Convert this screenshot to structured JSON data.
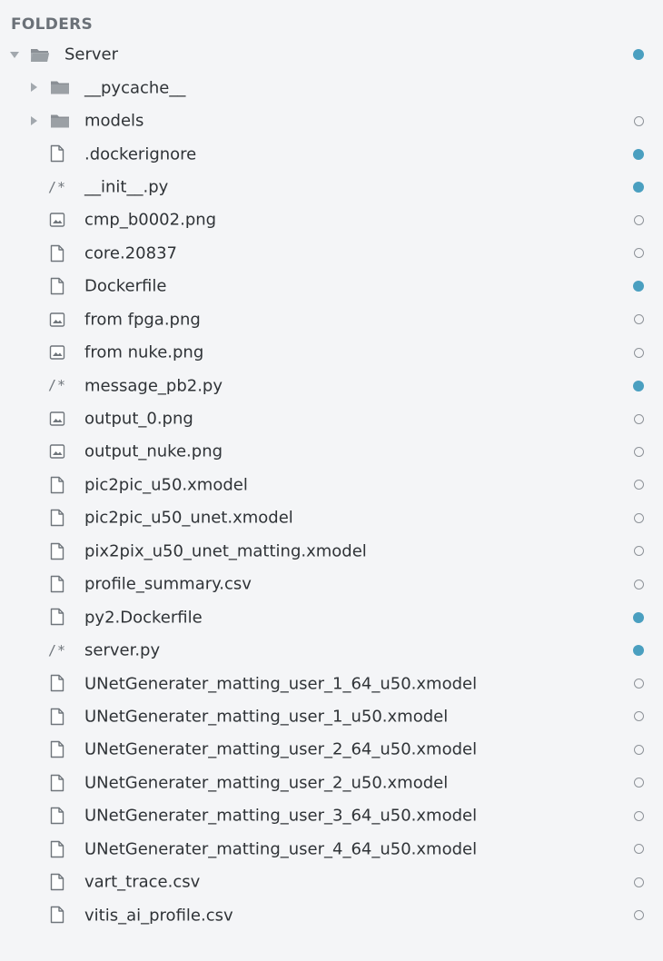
{
  "sidebar": {
    "header": "FOLDERS",
    "root": {
      "label": "Server",
      "icon": "folder-open-icon",
      "expanded": true,
      "status": "modified"
    },
    "items": [
      {
        "label": "__pycache__",
        "kind": "folder",
        "icon": "folder-icon",
        "expanded": false,
        "status": "none"
      },
      {
        "label": "models",
        "kind": "folder",
        "icon": "folder-icon",
        "expanded": false,
        "status": "clean"
      },
      {
        "label": ".dockerignore",
        "kind": "file",
        "icon": "file-icon",
        "status": "modified"
      },
      {
        "label": "__init__.py",
        "kind": "code",
        "icon": "code-file-icon",
        "glyph": "/*",
        "status": "modified"
      },
      {
        "label": "cmp_b0002.png",
        "kind": "image",
        "icon": "image-file-icon",
        "status": "clean"
      },
      {
        "label": "core.20837",
        "kind": "file",
        "icon": "file-icon",
        "status": "clean"
      },
      {
        "label": "Dockerfile",
        "kind": "file",
        "icon": "file-icon",
        "status": "modified"
      },
      {
        "label": "from fpga.png",
        "kind": "image",
        "icon": "image-file-icon",
        "status": "clean"
      },
      {
        "label": "from nuke.png",
        "kind": "image",
        "icon": "image-file-icon",
        "status": "clean"
      },
      {
        "label": "message_pb2.py",
        "kind": "code",
        "icon": "code-file-icon",
        "glyph": "/*",
        "status": "modified"
      },
      {
        "label": "output_0.png",
        "kind": "image",
        "icon": "image-file-icon",
        "status": "clean"
      },
      {
        "label": "output_nuke.png",
        "kind": "image",
        "icon": "image-file-icon",
        "status": "clean"
      },
      {
        "label": "pic2pic_u50.xmodel",
        "kind": "file",
        "icon": "file-icon",
        "status": "clean"
      },
      {
        "label": "pic2pic_u50_unet.xmodel",
        "kind": "file",
        "icon": "file-icon",
        "status": "clean"
      },
      {
        "label": "pix2pix_u50_unet_matting.xmodel",
        "kind": "file",
        "icon": "file-icon",
        "status": "clean"
      },
      {
        "label": "profile_summary.csv",
        "kind": "file",
        "icon": "file-icon",
        "status": "clean"
      },
      {
        "label": "py2.Dockerfile",
        "kind": "file",
        "icon": "file-icon",
        "status": "modified"
      },
      {
        "label": "server.py",
        "kind": "code",
        "icon": "code-file-icon",
        "glyph": "/*",
        "status": "modified"
      },
      {
        "label": "UNetGenerater_matting_user_1_64_u50.xmodel",
        "kind": "file",
        "icon": "file-icon",
        "status": "clean"
      },
      {
        "label": "UNetGenerater_matting_user_1_u50.xmodel",
        "kind": "file",
        "icon": "file-icon",
        "status": "clean"
      },
      {
        "label": "UNetGenerater_matting_user_2_64_u50.xmodel",
        "kind": "file",
        "icon": "file-icon",
        "status": "clean"
      },
      {
        "label": "UNetGenerater_matting_user_2_u50.xmodel",
        "kind": "file",
        "icon": "file-icon",
        "status": "clean"
      },
      {
        "label": "UNetGenerater_matting_user_3_64_u50.xmodel",
        "kind": "file",
        "icon": "file-icon",
        "status": "clean"
      },
      {
        "label": "UNetGenerater_matting_user_4_64_u50.xmodel",
        "kind": "file",
        "icon": "file-icon",
        "status": "clean"
      },
      {
        "label": "vart_trace.csv",
        "kind": "file",
        "icon": "file-icon",
        "status": "clean"
      },
      {
        "label": "vitis_ai_profile.csv",
        "kind": "file",
        "icon": "file-icon",
        "status": "clean"
      }
    ]
  },
  "colors": {
    "modified": "#4a9fc0",
    "clean_ring": "#8e9399",
    "folder": "#8a8f95",
    "background": "#f4f5f7"
  }
}
